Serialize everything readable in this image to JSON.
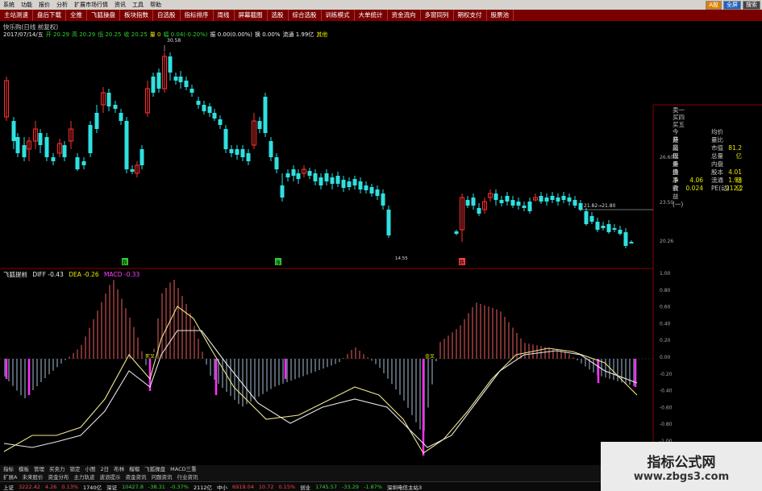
{
  "menu": [
    "系统",
    "功能",
    "报价",
    "分析",
    "扩展市场行情",
    "资讯",
    "工具",
    "帮助"
  ],
  "window_corner": [
    "A股",
    "全屏",
    "搜索"
  ],
  "toolbar": [
    "主站测速",
    "盘后下载",
    "全推",
    "飞狐操盘",
    "板块指数",
    "自选股",
    "指标排序",
    "周线",
    "屏幕截图",
    "选股",
    "综合选股",
    "训练模式",
    "大单统计",
    "资金流向",
    "多窗同列",
    "期权支付",
    "股票池"
  ],
  "title": "快乐购(日线 前复权)",
  "ohlc": [
    {
      "text": "2017/07/14/五",
      "color": "white"
    },
    {
      "text": "开 20.29",
      "color": "green"
    },
    {
      "text": "高 20.29",
      "color": "green"
    },
    {
      "text": "低 20.25",
      "color": "green"
    },
    {
      "text": "收 20.25",
      "color": "green"
    },
    {
      "text": "量 0",
      "color": "yellow"
    },
    {
      "text": "幅 0.04(-0.20%)",
      "color": "green"
    },
    {
      "text": "振 0.00(0.00%)",
      "color": "white"
    },
    {
      "text": "换 0.00%",
      "color": "white"
    },
    {
      "text": "流通 1.99亿",
      "color": "white"
    },
    {
      "text": "其他",
      "color": "yellow"
    }
  ],
  "price_annotations": {
    "high": "30.58",
    "range": "21.82→21.80",
    "low": "14.55"
  },
  "price_axis_ticks": [
    "26.60",
    "23.50",
    "20.26"
  ],
  "info_panel": {
    "orderbook": [
      "卖一",
      "买四",
      "买五"
    ],
    "rows": [
      {
        "k": "今开",
        "v": "",
        "k2": "均价",
        "v2": ""
      },
      {
        "k": "最高",
        "v": "",
        "k2": "量比",
        "v2": ""
      },
      {
        "k": "最低",
        "v": "",
        "k2": "市值",
        "v2": "81.2亿"
      },
      {
        "k": "现量",
        "v": "",
        "k2": "总量",
        "v2": ""
      },
      {
        "k": "外盘",
        "v": "",
        "k2": "内盘",
        "v2": ""
      },
      {
        "k": "换手",
        "v": "",
        "k2": "股本",
        "v2": "4.01亿"
      },
      {
        "k": "净资",
        "v": "4.06",
        "k2": "流通",
        "v2": "1.99亿"
      },
      {
        "k": "收益(一)",
        "v": "0.024",
        "k2": "PE(动)",
        "v2": "212.2"
      }
    ]
  },
  "macd": {
    "name": "飞狐提前",
    "diff": "DIFF -0.43",
    "dea": "DEA -0.26",
    "macd": "MACD -0.33",
    "cross_labels": [
      "死叉",
      "金叉"
    ],
    "axis": [
      "1.00",
      "0.80",
      "0.60",
      "0.40",
      "0.20",
      "0.00",
      "-0.20",
      "-0.40",
      "-0.60",
      "-0.80",
      "-1.00"
    ]
  },
  "signal_marks": [
    "跌",
    "涨",
    "跌"
  ],
  "bottom_tabs": [
    "指标",
    "模板",
    "管理",
    "买卖力",
    "锁定",
    "小图",
    "2日",
    "布林",
    "榴榴",
    "飞狐操盘",
    "MACD三重"
  ],
  "bottom_tabs2": [
    "扩展A",
    "未来股价",
    "资金分布",
    "主力轨迹",
    "波浪提示",
    "资金资讯",
    "问题资讯",
    "行业资讯"
  ],
  "statusbar": [
    {
      "text": "上证",
      "color": "white"
    },
    {
      "text": "3222.42",
      "color": "red"
    },
    {
      "text": "4.26",
      "color": "red"
    },
    {
      "text": "0.13%",
      "color": "red"
    },
    {
      "text": "1740亿",
      "color": "white"
    },
    {
      "text": "深证",
      "color": "white"
    },
    {
      "text": "10427.8",
      "color": "green"
    },
    {
      "text": "-38.31",
      "color": "green"
    },
    {
      "text": "-0.37%",
      "color": "green"
    },
    {
      "text": "2112亿",
      "color": "white"
    },
    {
      "text": "中小",
      "color": "white"
    },
    {
      "text": "6919.04",
      "color": "red"
    },
    {
      "text": "10.72",
      "color": "red"
    },
    {
      "text": "0.15%",
      "color": "red"
    },
    {
      "text": "创业",
      "color": "white"
    },
    {
      "text": "1745.57",
      "color": "green"
    },
    {
      "text": "-33.29",
      "color": "green"
    },
    {
      "text": "-1.87%",
      "color": "green"
    },
    {
      "text": "深圳电信主站3",
      "color": "white"
    }
  ],
  "watermark": {
    "line1": "指标公式网",
    "line2": "www.zbgs3.com"
  }
}
